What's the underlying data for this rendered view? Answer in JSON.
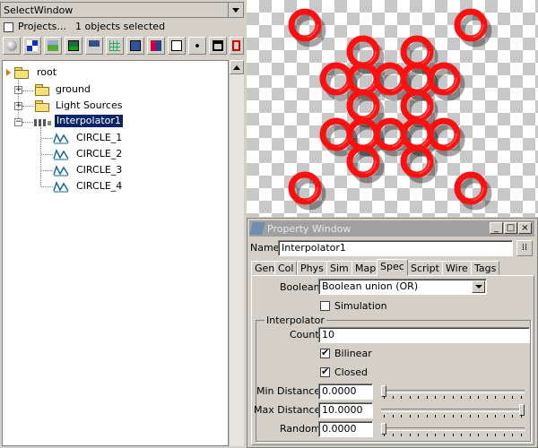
{
  "select_window": {
    "title": "SelectWindow",
    "projects_label": "Projects...",
    "projects_checked": false,
    "selection_status": "1 objects selected",
    "toolbar_icons": [
      "sphere-icon",
      "checker-icon",
      "landscape-icon",
      "image-icon",
      "save-icon",
      "grid-icon",
      "render-icon",
      "texture-icon",
      "node-icon",
      "graph-icon",
      "window-icon",
      "frame-icon"
    ]
  },
  "tree": {
    "root": "root",
    "children": [
      {
        "label": "ground",
        "icon": "folder-icon"
      },
      {
        "label": "Light Sources",
        "icon": "folder-icon"
      },
      {
        "label": "Interpolator1",
        "icon": "interpolator-icon",
        "selected": true,
        "children": [
          "CIRCLE_1",
          "CIRCLE_2",
          "CIRCLE_3",
          "CIRCLE_4"
        ]
      }
    ]
  },
  "viewport": {
    "ring_color": "#ff1010",
    "checker_light": "#ffffff",
    "checker_dark": "#c8c8c8"
  },
  "property_window": {
    "title": "Property Window",
    "name_label": "Name",
    "name_value": "Interpolator1",
    "tabs": [
      "Gen",
      "Col",
      "Phys",
      "Sim",
      "Map",
      "Spec",
      "Script",
      "Wire",
      "Tags"
    ],
    "active_tab": "Spec",
    "boolean_label": "Boolean",
    "boolean_value": "Boolean union (OR)",
    "simulation_label": "Simulation",
    "simulation_checked": false,
    "group_label": "Interpolator",
    "count_label": "Count",
    "count_value": "10",
    "bilinear_label": "Bilinear",
    "bilinear_checked": true,
    "closed_label": "Closed",
    "closed_checked": true,
    "min_distance_label": "Min Distance",
    "min_distance_value": "0.0000",
    "min_distance_slider": 0.0,
    "max_distance_label": "Max Distance",
    "max_distance_value": "10.0000",
    "max_distance_slider": 1.0,
    "random_label": "Random",
    "random_value": "0.0000",
    "random_slider": 0.0
  }
}
